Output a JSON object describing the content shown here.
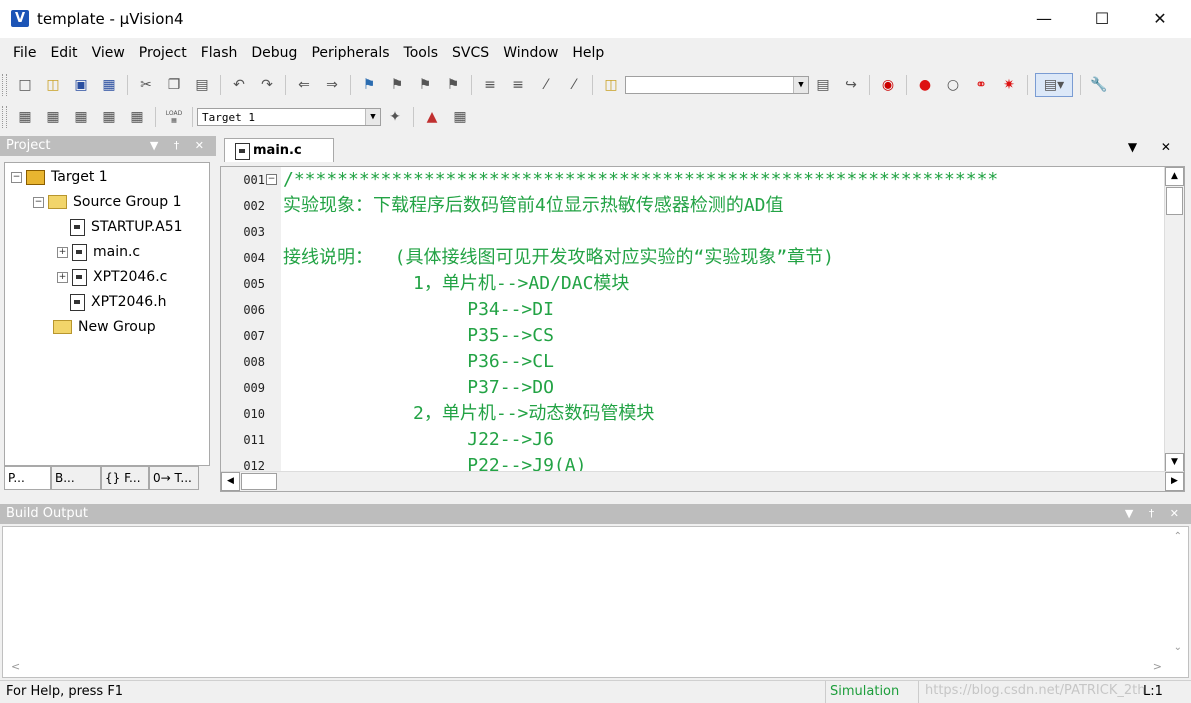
{
  "window": {
    "title": "template  - µVision4",
    "icon_letter": "V",
    "minimize": "—",
    "maximize": "☐",
    "close": "✕"
  },
  "menu": [
    "File",
    "Edit",
    "View",
    "Project",
    "Flash",
    "Debug",
    "Peripherals",
    "Tools",
    "SVCS",
    "Window",
    "Help"
  ],
  "toolbar": {
    "target_select": "Target 1",
    "load_label": "LOAD"
  },
  "project_panel": {
    "title": "Project",
    "tree": {
      "target": "Target 1",
      "group": "Source Group 1",
      "files": [
        "STARTUP.A51",
        "main.c",
        "XPT2046.c",
        "XPT2046.h"
      ],
      "new_group": "New Group"
    },
    "tabs": [
      "P...",
      "B...",
      "{} F...",
      "0→ T..."
    ]
  },
  "editor": {
    "tab": "main.c",
    "lines": [
      {
        "n": "001",
        "text": "/*****************************************************************"
      },
      {
        "n": "002",
        "text": "实验现象：下载程序后数码管前4位显示热敏传感器检测的AD值"
      },
      {
        "n": "003",
        "text": ""
      },
      {
        "n": "004",
        "text": "接线说明：  (具体接线图可见开发攻略对应实验的“实验现象”章节)"
      },
      {
        "n": "005",
        "text": "            1，单片机-->AD/DAC模块"
      },
      {
        "n": "006",
        "text": "                 P34-->DI"
      },
      {
        "n": "007",
        "text": "                 P35-->CS"
      },
      {
        "n": "008",
        "text": "                 P36-->CL"
      },
      {
        "n": "009",
        "text": "                 P37-->DO"
      },
      {
        "n": "010",
        "text": "            2，单片机-->动态数码管模块"
      },
      {
        "n": "011",
        "text": "                 J22-->J6"
      },
      {
        "n": "012",
        "text": "                 P22-->J9(A)"
      }
    ]
  },
  "build_output": {
    "title": "Build Output"
  },
  "status": {
    "help": "For Help, press F1",
    "mode": "Simulation",
    "position": "L:1",
    "watermark": "https://blog.csdn.net/PATRICK_2th"
  },
  "colors": {
    "code_text": "#23a345",
    "panel_header": "#bdbdbd"
  }
}
